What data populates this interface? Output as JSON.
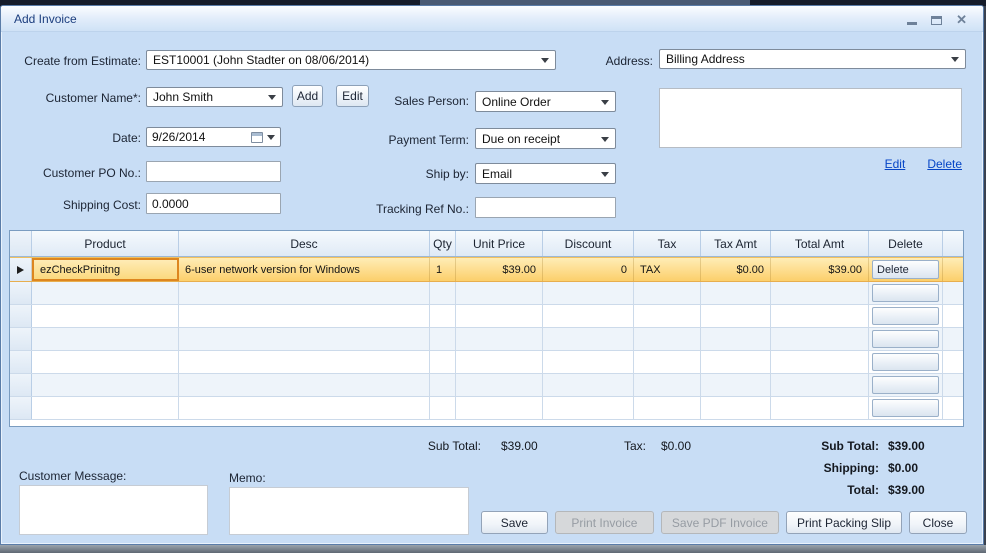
{
  "window": {
    "title": "Add Invoice"
  },
  "form": {
    "create_from_estimate": {
      "label": "Create from Estimate:",
      "value": "EST10001 (John Stadter on 08/06/2014)"
    },
    "address": {
      "label": "Address:",
      "value": "Billing Address",
      "box_text": "",
      "edit_link": "Edit",
      "delete_link": "Delete"
    },
    "customer_name": {
      "label": "Customer Name*:",
      "value": "John Smith",
      "add_button": "Add",
      "edit_button": "Edit"
    },
    "sales_person": {
      "label": "Sales Person:",
      "value": "Online Order"
    },
    "date": {
      "label": "Date:",
      "value": "9/26/2014"
    },
    "payment_term": {
      "label": "Payment Term:",
      "value": "Due on receipt"
    },
    "customer_po": {
      "label": "Customer PO No.:",
      "value": ""
    },
    "ship_by": {
      "label": "Ship by:",
      "value": "Email"
    },
    "shipping_cost": {
      "label": "Shipping Cost:",
      "value": "0.0000"
    },
    "tracking_ref": {
      "label": "Tracking Ref No.:",
      "value": ""
    }
  },
  "grid": {
    "columns": [
      "Product",
      "Desc",
      "Qty",
      "Unit Price",
      "Discount",
      "Tax",
      "Tax Amt",
      "Total Amt",
      "Delete"
    ],
    "rows": [
      {
        "product": "ezCheckPrinitng",
        "desc": "6-user network version for Windows",
        "qty": "1",
        "unit_price": "$39.00",
        "discount": "0",
        "tax": "TAX",
        "tax_amt": "$0.00",
        "total_amt": "$39.00",
        "delete_label": "Delete"
      }
    ],
    "empty_row_count": 6
  },
  "totals": {
    "sub_total_label": "Sub Total:",
    "sub_total_value": "$39.00",
    "tax_label": "Tax:",
    "tax_value": "$0.00",
    "summary": [
      {
        "label": "Sub Total:",
        "value": "$39.00"
      },
      {
        "label": "Shipping:",
        "value": "$0.00"
      },
      {
        "label": "Total:",
        "value": "$39.00"
      }
    ]
  },
  "bottom": {
    "customer_message_label": "Customer Message:",
    "customer_message_value": "",
    "memo_label": "Memo:",
    "memo_value": "",
    "buttons": [
      {
        "label": "Save",
        "enabled": true
      },
      {
        "label": "Print Invoice",
        "enabled": false
      },
      {
        "label": "Save PDF Invoice",
        "enabled": false
      },
      {
        "label": "Print Packing Slip",
        "enabled": true
      },
      {
        "label": "Close",
        "enabled": true
      }
    ]
  },
  "colors": {
    "selected_row": "#fccf6b",
    "selected_cell_border": "#dd861f",
    "link": "#0645c6",
    "dialog_bg": "#c8ddf5"
  }
}
